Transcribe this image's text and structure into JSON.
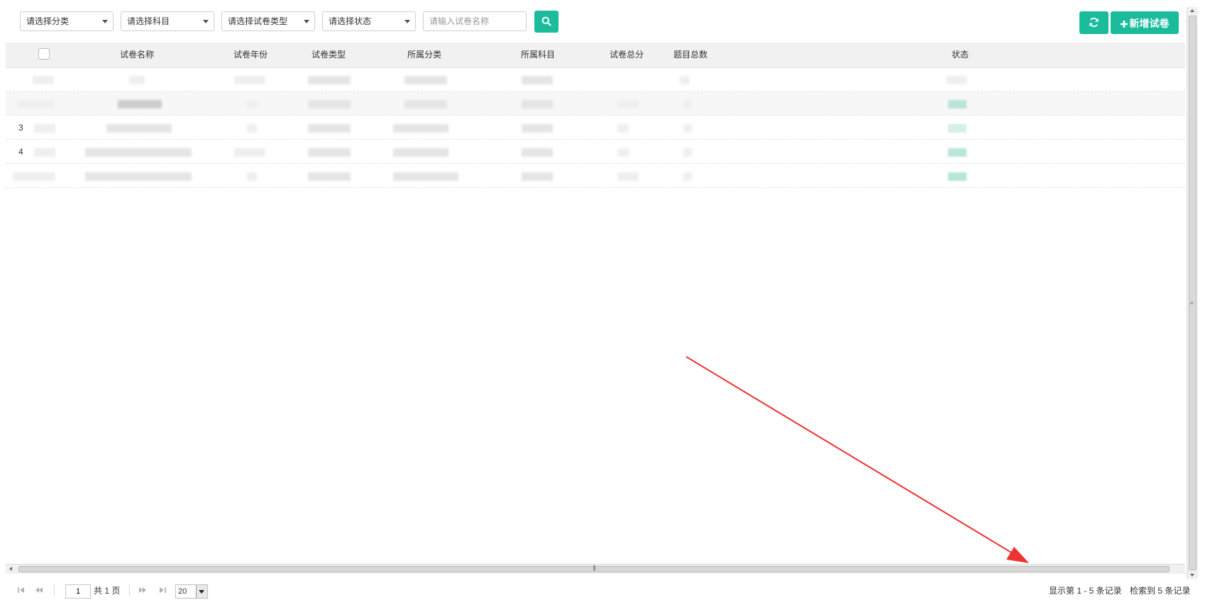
{
  "filters": {
    "category": {
      "selected": "请选择分类"
    },
    "subject": {
      "selected": "请选择科目"
    },
    "paper_type": {
      "selected": "请选择试卷类型"
    },
    "status": {
      "selected": "请选择状态"
    },
    "search": {
      "placeholder": "请输入试卷名称",
      "value": ""
    }
  },
  "actions": {
    "add_label": "新增试卷"
  },
  "icons": {
    "search": "search-icon",
    "refresh": "refresh-icon",
    "add": "plus-icon"
  },
  "colors": {
    "accent": "#1abc9c",
    "annotation_arrow": "#ee3333"
  },
  "table": {
    "headers": {
      "name": "试卷名称",
      "year": "试卷年份",
      "type": "试卷类型",
      "category": "所属分类",
      "subject": "所属科目",
      "total_score": "试卷总分",
      "question_count": "题目总数",
      "status": "状态"
    },
    "rows": [
      {
        "index": ""
      },
      {
        "index": ""
      },
      {
        "index": "3"
      },
      {
        "index": "4"
      },
      {
        "index": ""
      }
    ]
  },
  "pager": {
    "current_page": "1",
    "total_pages": "共 1 页",
    "page_size": "20",
    "range_text": "显示第 1 - 5 条记录",
    "total_text": "检索到 5 条记录"
  }
}
